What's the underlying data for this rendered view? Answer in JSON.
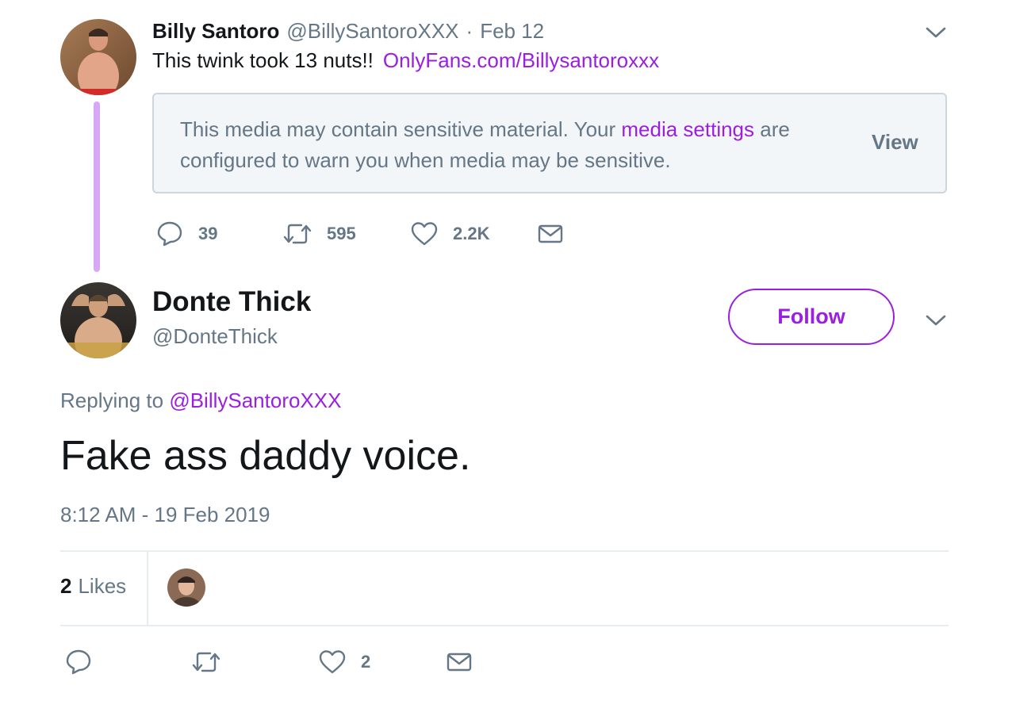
{
  "parent_tweet": {
    "name": "Billy Santoro",
    "handle": "@BillySantoroXXX",
    "separator": "·",
    "date": "Feb 12",
    "text": "This twink took 13 nuts!!",
    "link": "OnlyFans.com/Billysantoroxxx",
    "sensitive_notice": {
      "text_before": "This media may contain sensitive material. Your ",
      "link": "media settings",
      "text_after": " are configured to warn you when media may be sensitive.",
      "view_label": "View"
    },
    "actions": {
      "replies": "39",
      "retweets": "595",
      "likes": "2.2K"
    },
    "icons": [
      "reply-icon",
      "retweet-icon",
      "heart-icon",
      "envelope-icon",
      "chevron-down-icon"
    ]
  },
  "main_tweet": {
    "name": "Donte Thick",
    "handle": "@DonteThick",
    "follow_label": "Follow",
    "replying_prefix": "Replying to ",
    "replying_handle": "@BillySantoroXXX",
    "text": "Fake ass daddy voice.",
    "timestamp": "8:12 AM - 19 Feb 2019",
    "likes_count": "2",
    "likes_label": "Likes",
    "actions": {
      "likes": "2"
    }
  },
  "colors": {
    "accent": "#9b1fe0",
    "thread_line": "#d7a8f5",
    "secondary_text": "#657786",
    "primary_text": "#14171a",
    "notice_bg": "#f3f6f8"
  }
}
